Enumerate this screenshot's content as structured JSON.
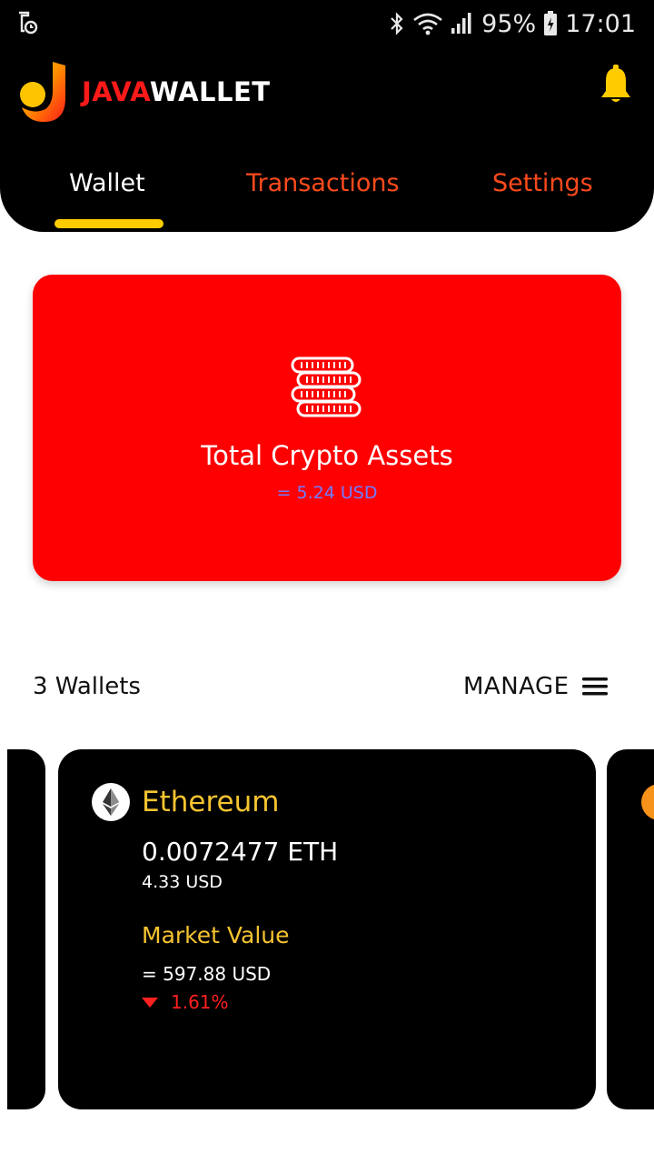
{
  "status_bar": {
    "battery": "95%",
    "time": "17:01"
  },
  "header": {
    "logo_part1": "JAVA",
    "logo_part2": "WALLET",
    "tabs": [
      {
        "label": "Wallet",
        "active": true
      },
      {
        "label": "Transactions",
        "active": false
      },
      {
        "label": "Settings",
        "active": false
      }
    ]
  },
  "assets_card": {
    "title": "Total Crypto Assets",
    "value": "= 5.24 USD"
  },
  "wallets": {
    "count_label": "3 Wallets",
    "manage_label": "MANAGE",
    "cards": [
      {
        "name": "Ethereum",
        "balance": "0.0072477 ETH",
        "balance_usd": "4.33 USD",
        "market_label": "Market Value",
        "market_value": "= 597.88 USD",
        "change": "1.61%"
      }
    ]
  },
  "colors": {
    "accent_yellow": "#ffcc00",
    "brand_red": "#ff0000",
    "tab_inactive": "#ff4a1c",
    "coin_name": "#f6c431",
    "change_down": "#ff2020",
    "usd_value": "#6f7dff"
  },
  "icons": [
    "app-notification-icon",
    "bluetooth-icon",
    "wifi-icon",
    "signal-icon",
    "battery-icon",
    "bell-icon",
    "coins-icon",
    "menu-icon",
    "ethereum-icon",
    "down-arrow-icon"
  ]
}
